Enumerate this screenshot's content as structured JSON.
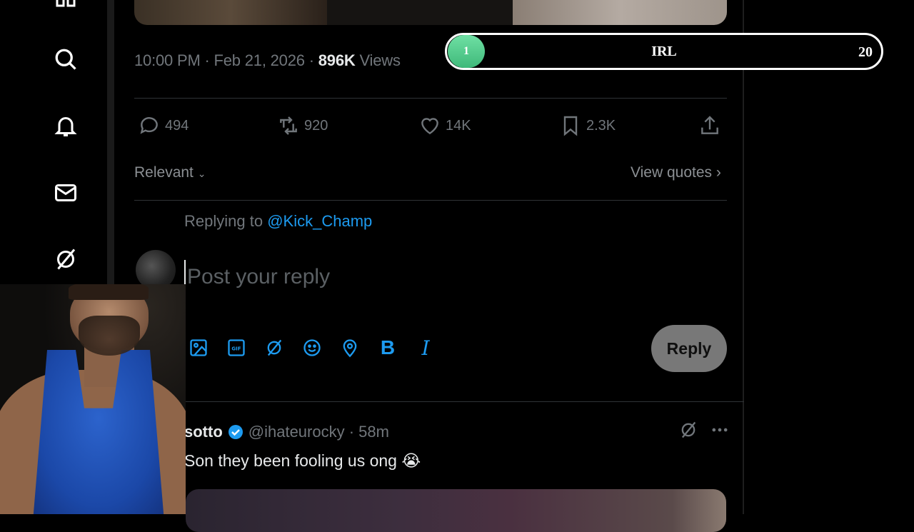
{
  "nav": {
    "icons": [
      "home-icon",
      "search-icon",
      "notifications-icon",
      "messages-icon",
      "grok-icon"
    ]
  },
  "tweet": {
    "time": "10:00 PM",
    "date": "Feb 21, 2026",
    "views_count": "896K",
    "views_label": "Views",
    "sep": " · "
  },
  "overlay": {
    "progress_current": "1",
    "progress_label": "IRL",
    "progress_max": "20",
    "accent": "#4cc98a"
  },
  "actions": {
    "replies": "494",
    "reposts": "920",
    "likes": "14K",
    "bookmarks": "2.3K"
  },
  "sort": {
    "label": "Relevant",
    "view_quotes": "View quotes"
  },
  "composer": {
    "replying_prefix": "Replying to",
    "replying_handle": "@Kick_Champ",
    "placeholder": "Post your reply",
    "reply_button": "Reply",
    "bold_label": "B",
    "italic_label": "I"
  },
  "reply_post": {
    "name": "sotto",
    "handle": "@ihateurocky",
    "time": "58m",
    "sep": " · ",
    "text": "Son they been fooling us ong",
    "emoji": "😭"
  },
  "colors": {
    "link": "#1d9bf0",
    "muted": "#71767b",
    "background": "#000000"
  }
}
